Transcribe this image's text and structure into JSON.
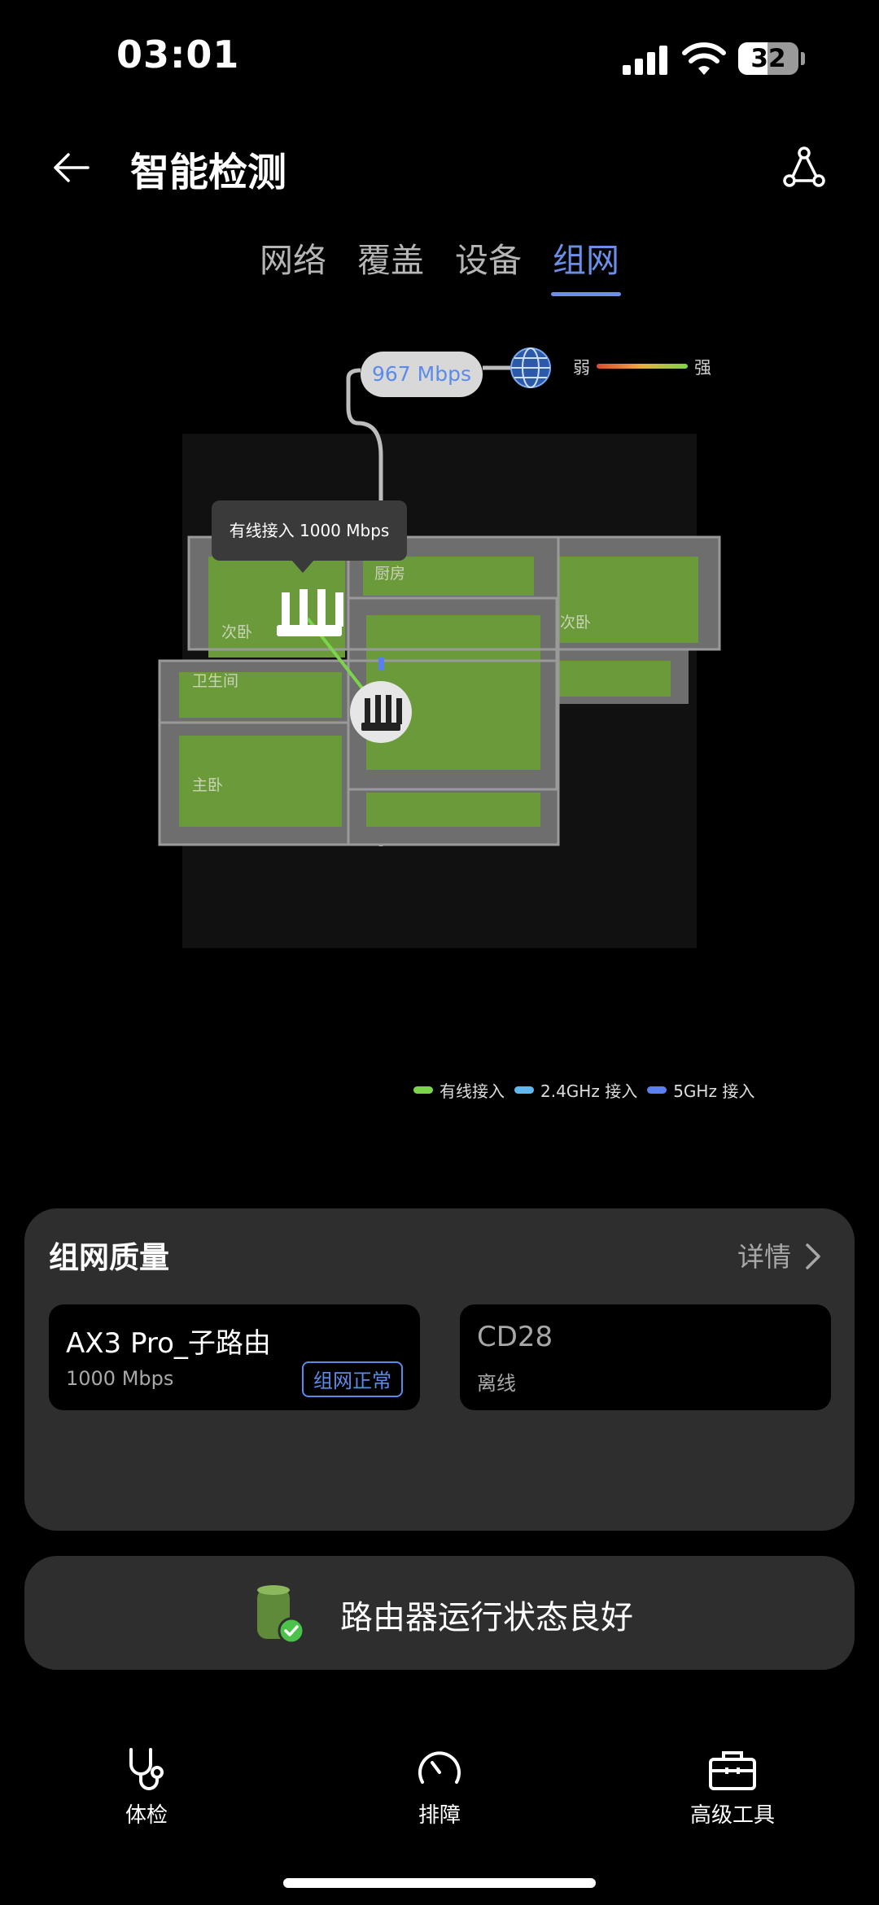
{
  "status_bar": {
    "time": "03:01",
    "battery": "32"
  },
  "header": {
    "title": "智能检测",
    "back_icon": "back-arrow-icon",
    "share_icon": "topology-icon"
  },
  "tabs": [
    {
      "label": "网络",
      "active": false
    },
    {
      "label": "覆盖",
      "active": false
    },
    {
      "label": "设备",
      "active": false
    },
    {
      "label": "组网",
      "active": true
    }
  ],
  "map": {
    "uplink_speed": "967 Mbps",
    "signal_scale": {
      "low": "弱",
      "high": "强"
    },
    "tooltip": "有线接入 1000 Mbps",
    "rooms": {
      "kitchen": "厨房",
      "bedroom_left": "次卧",
      "bedroom_right": "次卧",
      "bathroom": "卫生间",
      "master": "主卧"
    }
  },
  "legend": [
    {
      "label": "有线接入",
      "color": "#7bd44a"
    },
    {
      "label": "2.4GHz 接入",
      "color": "#5fb8f0"
    },
    {
      "label": "5GHz 接入",
      "color": "#5b7ff0"
    }
  ],
  "quality": {
    "title": "组网质量",
    "detail": "详情",
    "nodes": [
      {
        "name": "AX3 Pro_子路由",
        "sub": "1000 Mbps",
        "badge": "组网正常"
      },
      {
        "name": "CD28",
        "sub": "离线"
      }
    ]
  },
  "status": {
    "text": "路由器运行状态良好"
  },
  "nav": [
    {
      "label": "体检",
      "icon": "stethoscope-icon"
    },
    {
      "label": "排障",
      "icon": "gauge-icon"
    },
    {
      "label": "高级工具",
      "icon": "toolbox-icon"
    }
  ],
  "colors": {
    "accent": "#6b8fe8",
    "wired": "#7bd44a",
    "card_bg": "#2e2e2e"
  }
}
